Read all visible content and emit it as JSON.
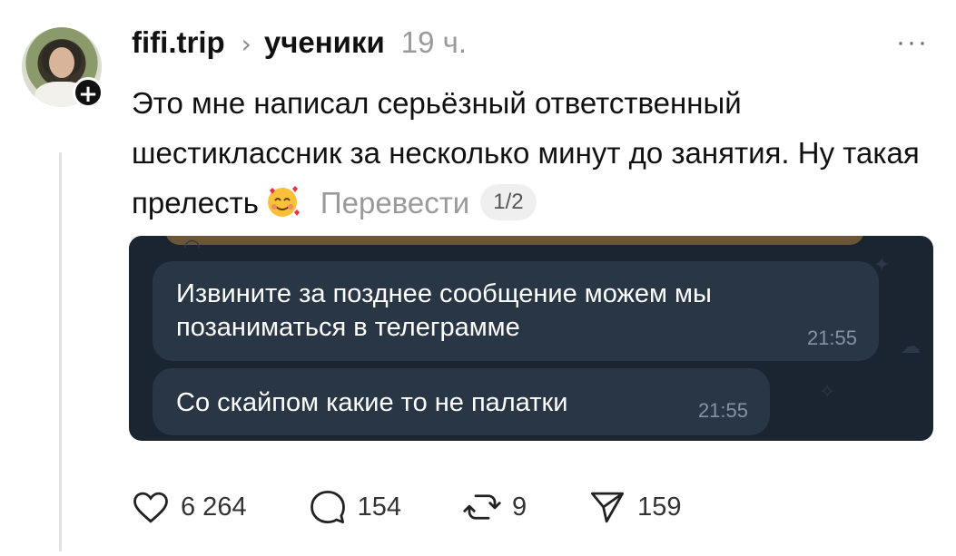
{
  "post": {
    "username": "fifi.trip",
    "separator": "›",
    "community": "ученики",
    "time": "19 ч.",
    "more": "···",
    "follow": "+",
    "text": "Это мне написал серьёзный ответственный шестиклассник за несколько минут до занятия. Ну такая прелесть",
    "translate": "Перевести",
    "page_indicator": "1/2"
  },
  "media": {
    "messages": [
      {
        "text": "Извините за позднее сообщение можем мы позаниматься в телеграмме",
        "time": "21:55"
      },
      {
        "text": "Со скайпом какие то не палатки",
        "time": "21:55"
      }
    ]
  },
  "actions": {
    "likes": "6 264",
    "comments": "154",
    "reposts": "9",
    "shares": "159"
  },
  "icons": [
    "heart-icon",
    "comment-icon",
    "repost-icon",
    "share-icon",
    "more-icon",
    "smiling-face-with-hearts-emoji"
  ]
}
